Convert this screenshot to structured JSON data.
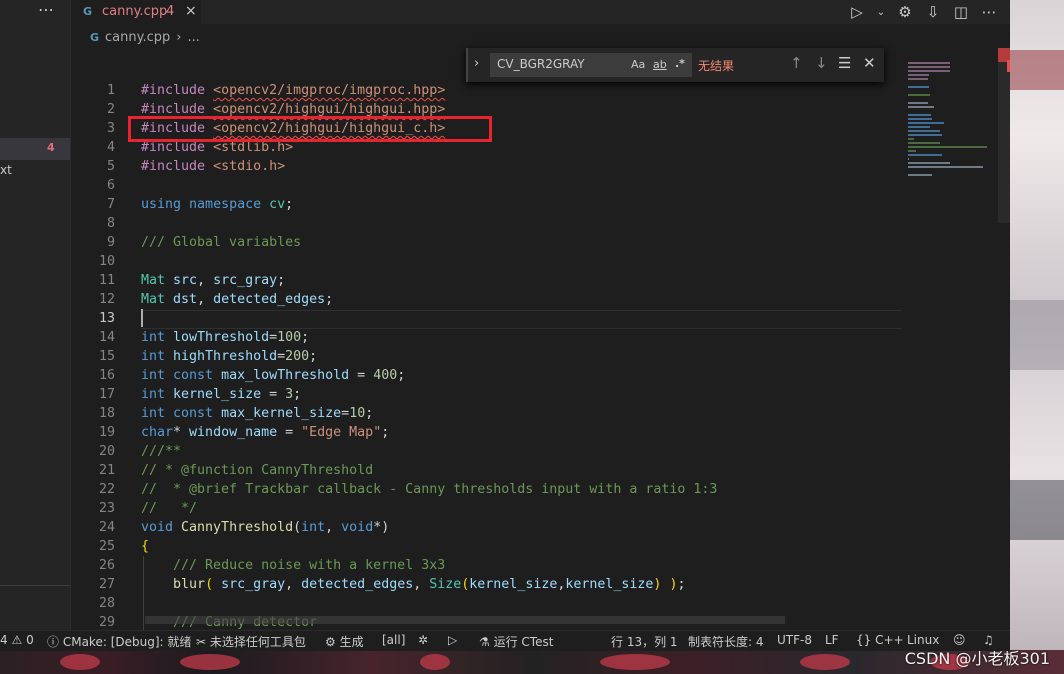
{
  "sidebar": {
    "more_icon": "ellipsis-icon",
    "badge": "4",
    "text_fragment": "xt"
  },
  "tab": {
    "filename": "canny.cpp",
    "problem_count": "4",
    "file_icon": "G"
  },
  "toolbar": {
    "icons": [
      "run-icon",
      "chevron-down-icon",
      "gear-icon",
      "save-icon",
      "split-editor-icon",
      "ellipsis-icon"
    ]
  },
  "breadcrumb": {
    "file": "canny.cpp",
    "separator": "›",
    "more": "..."
  },
  "find": {
    "query": "CV_BGR2GRAY",
    "match_case": "Aa",
    "whole_word": "ab",
    "regex": ".*",
    "status": "无结果"
  },
  "editor": {
    "current_line": 13,
    "lines": [
      {
        "n": "1",
        "t": [
          [
            "pp",
            "#include "
          ],
          [
            "st sq",
            "<opencv2/imgproc/imgproc.hpp>"
          ]
        ]
      },
      {
        "n": "2",
        "t": [
          [
            "pp",
            "#include "
          ],
          [
            "st sq",
            "<opencv2/highgui/highgui.hpp>"
          ]
        ]
      },
      {
        "n": "3",
        "t": [
          [
            "pp",
            "#include "
          ],
          [
            "st sq",
            "<opencv2/highgui/highgui_c.h>"
          ]
        ]
      },
      {
        "n": "4",
        "t": [
          [
            "pp",
            "#include "
          ],
          [
            "st",
            "<stdlib.h>"
          ]
        ]
      },
      {
        "n": "5",
        "t": [
          [
            "pp",
            "#include "
          ],
          [
            "st",
            "<stdio.h>"
          ]
        ]
      },
      {
        "n": "6",
        "t": []
      },
      {
        "n": "7",
        "t": [
          [
            "kw",
            "using "
          ],
          [
            "kw",
            "namespace "
          ],
          [
            "ty",
            "cv"
          ],
          [
            "pl",
            ";"
          ]
        ]
      },
      {
        "n": "8",
        "t": []
      },
      {
        "n": "9",
        "t": [
          [
            "cm",
            "/// Global variables"
          ]
        ]
      },
      {
        "n": "10",
        "t": []
      },
      {
        "n": "11",
        "t": [
          [
            "ty",
            "Mat "
          ],
          [
            "va",
            "src"
          ],
          [
            "pl",
            ", "
          ],
          [
            "va",
            "src_gray"
          ],
          [
            "pl",
            ";"
          ]
        ]
      },
      {
        "n": "12",
        "t": [
          [
            "ty",
            "Mat "
          ],
          [
            "va",
            "dst"
          ],
          [
            "pl",
            ", "
          ],
          [
            "va",
            "detected_edges"
          ],
          [
            "pl",
            ";"
          ]
        ]
      },
      {
        "n": "13",
        "t": []
      },
      {
        "n": "14",
        "t": [
          [
            "kw",
            "int "
          ],
          [
            "va",
            "lowThreshold"
          ],
          [
            "pl",
            "="
          ],
          [
            "nu",
            "100"
          ],
          [
            "pl",
            ";"
          ]
        ]
      },
      {
        "n": "15",
        "t": [
          [
            "kw",
            "int "
          ],
          [
            "va",
            "highThreshold"
          ],
          [
            "pl",
            "="
          ],
          [
            "nu",
            "200"
          ],
          [
            "pl",
            ";"
          ]
        ]
      },
      {
        "n": "16",
        "t": [
          [
            "kw",
            "int "
          ],
          [
            "kw",
            "const "
          ],
          [
            "va",
            "max_lowThreshold"
          ],
          [
            "pl",
            " = "
          ],
          [
            "nu",
            "400"
          ],
          [
            "pl",
            ";"
          ]
        ]
      },
      {
        "n": "17",
        "t": [
          [
            "kw",
            "int "
          ],
          [
            "va",
            "kernel_size"
          ],
          [
            "pl",
            " = "
          ],
          [
            "nu",
            "3"
          ],
          [
            "pl",
            ";"
          ]
        ]
      },
      {
        "n": "18",
        "t": [
          [
            "kw",
            "int "
          ],
          [
            "kw",
            "const "
          ],
          [
            "va",
            "max_kernel_size"
          ],
          [
            "pl",
            "="
          ],
          [
            "nu",
            "10"
          ],
          [
            "pl",
            ";"
          ]
        ]
      },
      {
        "n": "19",
        "t": [
          [
            "kw",
            "char"
          ],
          [
            "pl",
            "* "
          ],
          [
            "va",
            "window_name"
          ],
          [
            "pl",
            " = "
          ],
          [
            "st",
            "\"Edge Map\""
          ],
          [
            "pl",
            ";"
          ]
        ]
      },
      {
        "n": "20",
        "t": [
          [
            "cm",
            "///**"
          ]
        ]
      },
      {
        "n": "21",
        "t": [
          [
            "cm",
            "// * @function CannyThreshold"
          ]
        ]
      },
      {
        "n": "22",
        "t": [
          [
            "cm",
            "//  * @brief Trackbar callback - Canny thresholds input with a ratio 1:3"
          ]
        ]
      },
      {
        "n": "23",
        "t": [
          [
            "cm",
            "//   */"
          ]
        ]
      },
      {
        "n": "24",
        "t": [
          [
            "kw",
            "void "
          ],
          [
            "fn",
            "CannyThreshold"
          ],
          [
            "pl",
            "("
          ],
          [
            "kw",
            "int"
          ],
          [
            "pl",
            ", "
          ],
          [
            "kw",
            "void"
          ],
          [
            "pl",
            "*)"
          ]
        ]
      },
      {
        "n": "25",
        "t": [
          [
            "br",
            "{"
          ]
        ]
      },
      {
        "n": "26",
        "t": [
          [
            "pl",
            "    "
          ],
          [
            "cm",
            "/// Reduce noise with a kernel 3x3"
          ]
        ]
      },
      {
        "n": "27",
        "t": [
          [
            "pl",
            "    "
          ],
          [
            "fn",
            "blur"
          ],
          [
            "br",
            "( "
          ],
          [
            "va",
            "src_gray"
          ],
          [
            "pl",
            ", "
          ],
          [
            "va",
            "detected_edges"
          ],
          [
            "pl",
            ", "
          ],
          [
            "ty",
            "Size"
          ],
          [
            "br",
            "("
          ],
          [
            "va",
            "kernel_size"
          ],
          [
            "pl",
            ","
          ],
          [
            "va",
            "kernel_size"
          ],
          [
            "br",
            ")"
          ],
          [
            "pl",
            " "
          ],
          [
            "br",
            ")"
          ],
          [
            "pl",
            ";"
          ]
        ]
      },
      {
        "n": "28",
        "t": []
      },
      {
        "n": "29",
        "t": [
          [
            "pl",
            "    "
          ],
          [
            "cm",
            "/// Canny detector"
          ]
        ]
      }
    ]
  },
  "statusbar": {
    "errors": "4",
    "warnings": "0",
    "cmake": "CMake: [Debug]: 就绪",
    "kit": "未选择任何工具包",
    "build": "生成",
    "target": "[all]",
    "ctest": "运行 CTest",
    "position": "行 13，列 1",
    "tab_size": "制表符长度: 4",
    "encoding": "UTF-8",
    "eol": "LF",
    "language": "C++",
    "os": "Linux"
  },
  "watermark": "CSDN @小老板301",
  "colors": {
    "highlight_box": "#e8242f",
    "error": "#f48771",
    "editor_bg": "#1e1e1e"
  }
}
